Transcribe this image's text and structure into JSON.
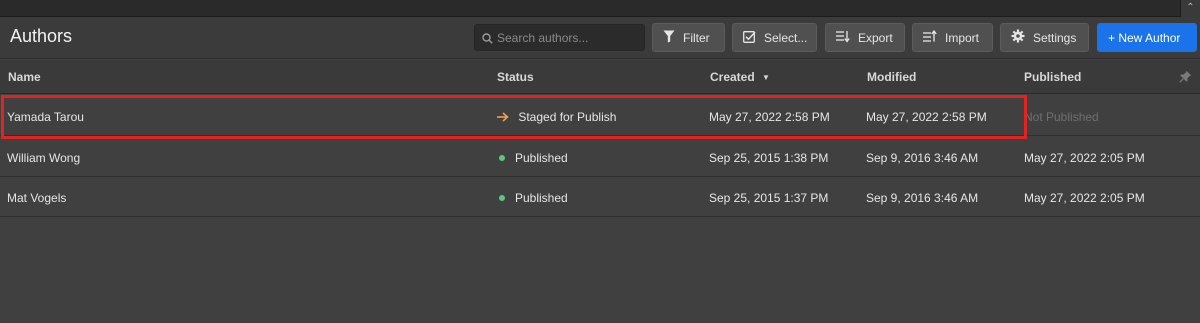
{
  "header": {
    "title": "Authors",
    "search_placeholder": "Search authors...",
    "buttons": {
      "filter": "Filter",
      "select": "Select...",
      "export": "Export",
      "import": "Import",
      "settings": "Settings",
      "new_author": "+ New Author"
    }
  },
  "columns": {
    "name": "Name",
    "status": "Status",
    "created": "Created",
    "modified": "Modified",
    "published": "Published"
  },
  "rows": [
    {
      "name": "Yamada Tarou",
      "status": "Staged for Publish",
      "status_kind": "staged",
      "created": "May 27, 2022 2:58 PM",
      "modified": "May 27, 2022 2:58 PM",
      "published": "Not Published"
    },
    {
      "name": "William Wong",
      "status": "Published",
      "status_kind": "published",
      "created": "Sep 25, 2015 1:38 PM",
      "modified": "Sep 9, 2016 3:46 AM",
      "published": "May 27, 2022 2:05 PM"
    },
    {
      "name": "Mat Vogels",
      "status": "Published",
      "status_kind": "published",
      "created": "Sep 25, 2015 1:37 PM",
      "modified": "Sep 9, 2016 3:46 AM",
      "published": "May 27, 2022 2:05 PM"
    }
  ],
  "colors": {
    "accent": "#1a73e8",
    "staged": "#f0a050",
    "published": "#5cc67b",
    "highlight_box": "#e32222"
  },
  "icons": {
    "search": "search-icon",
    "filter": "funnel-icon",
    "select": "checkbox-icon",
    "export": "export-icon",
    "import": "import-icon",
    "settings": "gear-icon",
    "sort": "sort-desc-icon",
    "pin": "pin-icon",
    "staged": "arrow-right-icon",
    "published": "dot-icon"
  }
}
